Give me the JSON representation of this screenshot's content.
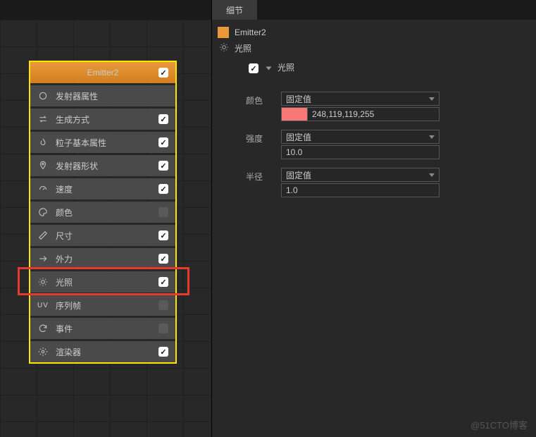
{
  "left": {
    "header": "Emitter2",
    "modules": [
      {
        "icon": "circle",
        "label": "发射器属性",
        "checked": null
      },
      {
        "icon": "swap",
        "label": "生成方式",
        "checked": true
      },
      {
        "icon": "flame",
        "label": "粒子基本属性",
        "checked": true
      },
      {
        "icon": "pin",
        "label": "发射器形状",
        "checked": true
      },
      {
        "icon": "gauge",
        "label": "速度",
        "checked": true
      },
      {
        "icon": "palette",
        "label": "颜色",
        "checked": false
      },
      {
        "icon": "ruler",
        "label": "尺寸",
        "checked": true
      },
      {
        "icon": "arrows",
        "label": "外力",
        "checked": true
      },
      {
        "icon": "sun",
        "label": "光照",
        "checked": true
      },
      {
        "icon": "uv",
        "label": "序列帧",
        "checked": false
      },
      {
        "icon": "refresh",
        "label": "事件",
        "checked": false
      },
      {
        "icon": "gear",
        "label": "渲染器",
        "checked": true
      }
    ]
  },
  "right": {
    "tab": "细节",
    "title": "Emitter2",
    "subtitle": "光照",
    "section": {
      "name": "光照",
      "checked": true,
      "props": [
        {
          "label": "颜色",
          "mode": "固定值",
          "valueType": "color",
          "value": "248,119,119,255",
          "swatch": "#f87777"
        },
        {
          "label": "强度",
          "mode": "固定值",
          "valueType": "num",
          "value": "10.0"
        },
        {
          "label": "半径",
          "mode": "固定值",
          "valueType": "num",
          "value": "1.0"
        }
      ]
    }
  },
  "watermark": "@51CTO博客"
}
